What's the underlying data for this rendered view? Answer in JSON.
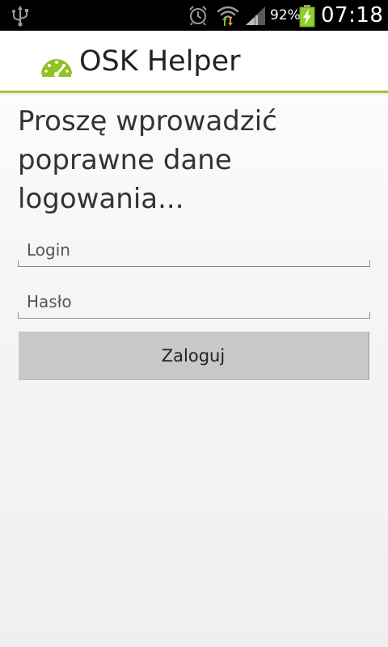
{
  "status_bar": {
    "battery_percent": "92%",
    "time": "07:18",
    "icons": [
      "usb-icon",
      "alarm-icon",
      "wifi-icon",
      "signal-icon",
      "battery-charging-icon"
    ]
  },
  "action_bar": {
    "title": "OSK Helper",
    "icon": "speedometer-icon",
    "accent_color": "#a4c639"
  },
  "login_form": {
    "prompt": "Proszę wprowadzić poprawne dane logowania...",
    "login_placeholder": "Login",
    "password_placeholder": "Hasło",
    "submit_label": "Zaloguj"
  }
}
